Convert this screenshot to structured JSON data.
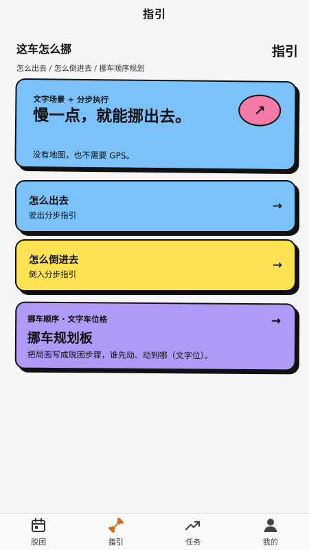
{
  "topbar": {
    "title": "指引"
  },
  "header": {
    "title": "这车怎么挪",
    "badge": "指引",
    "breadcrumb": "怎么出去 / 怎么倒进去 / 挪车顺序规划"
  },
  "hero": {
    "kicker": "文字场景 + 分步执行",
    "title": "慢一点，就能挪出去。",
    "subtitle": "没有地图，也不需要 GPS。",
    "action_icon": "↗"
  },
  "cards": {
    "out": {
      "title": "怎么出去",
      "subtitle": "驶出分步指引",
      "arrow": "→"
    },
    "reverse": {
      "title": "怎么倒进去",
      "subtitle": "倒入分步指引",
      "arrow": "→"
    }
  },
  "planner": {
    "kicker": "挪车顺序 · 文字车位格",
    "title": "挪车规划板",
    "subtitle": "把局面写成脱困步骤，谁先动、动到哪（文字位）。",
    "arrow": "→"
  },
  "tabs": [
    {
      "label": "脱困",
      "icon": "calendar-icon"
    },
    {
      "label": "指引",
      "icon": "dumbbell-icon",
      "active": true
    },
    {
      "label": "任务",
      "icon": "trend-up-icon"
    },
    {
      "label": "我的",
      "icon": "user-icon"
    }
  ],
  "colors": {
    "blue": "#7cc2fa",
    "yellow": "#fde253",
    "purple": "#b09af8",
    "pink": "#f47aa8",
    "accent_orange": "#d2691e"
  }
}
